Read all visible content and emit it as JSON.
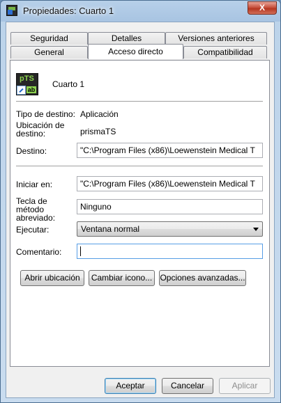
{
  "window": {
    "title": "Propiedades: Cuarto 1",
    "close_label": "X"
  },
  "tabs": {
    "row_top": [
      "Seguridad",
      "Detalles",
      "Versiones anteriores"
    ],
    "row_bottom": [
      "General",
      "Acceso directo",
      "Compatibilidad"
    ],
    "active": "Acceso directo"
  },
  "shortcut": {
    "icon_text_top": "pTS",
    "icon_text_badge": "ab",
    "name": "Cuarto 1",
    "target_type_label": "Tipo de destino:",
    "target_type_value": "Aplicación",
    "target_location_label": "Ubicación de destino:",
    "target_location_value": "prismaTS",
    "target_label": "Destino:",
    "target_value": "\"C:\\Program Files (x86)\\Loewenstein Medical T",
    "start_in_label": "Iniciar en:",
    "start_in_value": "\"C:\\Program Files (x86)\\Loewenstein Medical T",
    "shortcut_key_label": "Tecla de método abreviado:",
    "shortcut_key_value": "Ninguno",
    "run_label": "Ejecutar:",
    "run_value": "Ventana normal",
    "comment_label": "Comentario:",
    "comment_value": ""
  },
  "buttons": {
    "open_location": "Abrir ubicación",
    "change_icon": "Cambiar icono...",
    "advanced": "Opciones avanzadas..."
  },
  "footer": {
    "ok": "Aceptar",
    "cancel": "Cancelar",
    "apply": "Aplicar"
  }
}
